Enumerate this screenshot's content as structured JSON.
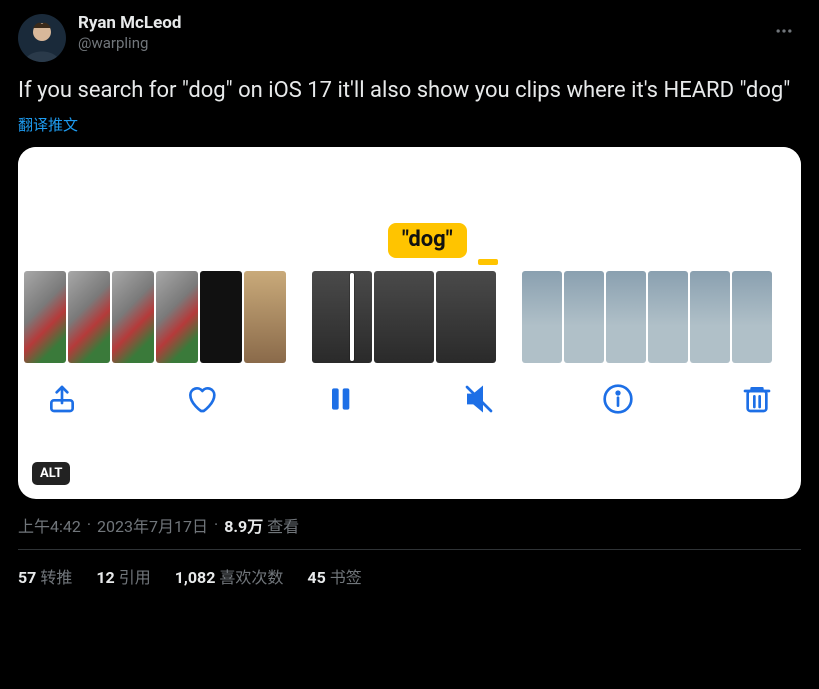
{
  "user": {
    "display_name": "Ryan McLeod",
    "handle": "@warpling"
  },
  "tweet": {
    "text": "If you search for \"dog\" on iOS 17 it'll also show you clips where it's HEARD \"dog\"",
    "translate_label": "翻译推文"
  },
  "media": {
    "bubble_text": "\"dog\"",
    "alt_badge": "ALT"
  },
  "meta": {
    "time": "上午4:42",
    "dot1": "·",
    "date": "2023年7月17日",
    "dot2": "·",
    "views_count": "8.9万",
    "views_label": "查看"
  },
  "stats": {
    "retweets_count": "57",
    "retweets_label": "转推",
    "quotes_count": "12",
    "quotes_label": "引用",
    "likes_count": "1,082",
    "likes_label": "喜欢次数",
    "bookmarks_count": "45",
    "bookmarks_label": "书签"
  }
}
